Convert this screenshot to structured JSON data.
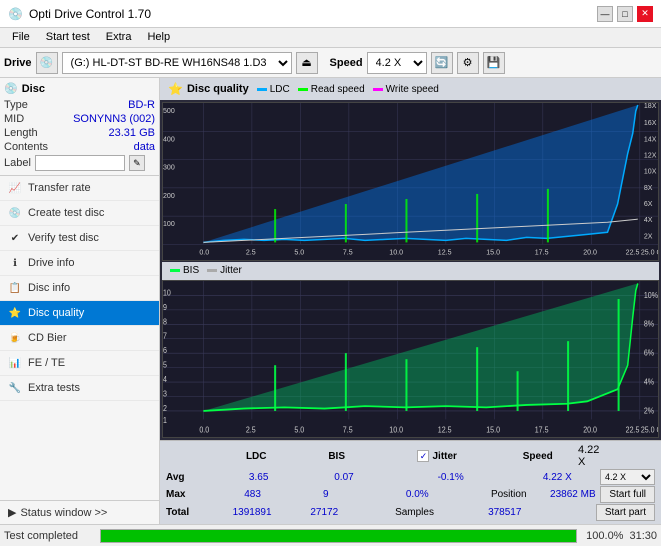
{
  "titleBar": {
    "title": "Opti Drive Control 1.70",
    "icon": "💿",
    "minimizeBtn": "—",
    "maximizeBtn": "□",
    "closeBtn": "✕"
  },
  "menuBar": {
    "items": [
      "File",
      "Start test",
      "Extra",
      "Help"
    ]
  },
  "driveBar": {
    "label": "Drive",
    "driveValue": "(G:)  HL-DT-ST BD-RE  WH16NS48 1.D3",
    "speedLabel": "Speed",
    "speedValue": "4.2 X"
  },
  "disc": {
    "title": "Disc",
    "typeLabel": "Type",
    "typeValue": "BD-R",
    "midLabel": "MID",
    "midValue": "SONYNN3 (002)",
    "lengthLabel": "Length",
    "lengthValue": "23.31 GB",
    "contentsLabel": "Contents",
    "contentsValue": "data",
    "labelLabel": "Label",
    "labelValue": ""
  },
  "nav": {
    "items": [
      {
        "id": "transfer-rate",
        "label": "Transfer rate",
        "icon": "📈"
      },
      {
        "id": "create-test-disc",
        "label": "Create test disc",
        "icon": "💿"
      },
      {
        "id": "verify-test-disc",
        "label": "Verify test disc",
        "icon": "✔"
      },
      {
        "id": "drive-info",
        "label": "Drive info",
        "icon": "ℹ"
      },
      {
        "id": "disc-info",
        "label": "Disc info",
        "icon": "📋"
      },
      {
        "id": "disc-quality",
        "label": "Disc quality",
        "icon": "⭐",
        "active": true
      },
      {
        "id": "cd-bier",
        "label": "CD Bier",
        "icon": "🍺"
      },
      {
        "id": "fe-te",
        "label": "FE / TE",
        "icon": "📊"
      },
      {
        "id": "extra-tests",
        "label": "Extra tests",
        "icon": "🔧"
      }
    ],
    "statusWindow": "Status window >>"
  },
  "discQuality": {
    "title": "Disc quality",
    "legend": {
      "ldc": "LDC",
      "readSpeed": "Read speed",
      "writeSpeed": "Write speed"
    },
    "legend2": {
      "bis": "BIS",
      "jitter": "Jitter"
    }
  },
  "stats": {
    "headers": [
      "LDC",
      "BIS",
      "Jitter",
      "Speed"
    ],
    "avgLabel": "Avg",
    "avgLDC": "3.65",
    "avgBIS": "0.07",
    "avgJitter": "-0.1%",
    "avgSpeed": "",
    "maxLabel": "Max",
    "maxLDC": "483",
    "maxBIS": "9",
    "maxJitter": "0.0%",
    "maxSpeed": "",
    "totalLabel": "Total",
    "totalLDC": "1391891",
    "totalBIS": "27172",
    "positionLabel": "Position",
    "positionValue": "23862 MB",
    "samplesLabel": "Samples",
    "samplesValue": "378517",
    "speedValue": "4.22 X",
    "speedSelect": "4.2 X",
    "startFullBtn": "Start full",
    "startPartBtn": "Start part"
  },
  "bottomBar": {
    "statusText": "Test completed",
    "progressPct": 100,
    "progressLabel": "100.0%",
    "timeLabel": "31:30"
  },
  "colors": {
    "accent": "#0078d4",
    "ldcColor": "#00aaff",
    "bisColor": "#00ff44",
    "jitterColor": "#ffffff",
    "readColor": "#00ff00",
    "writeColor": "#ff00ff",
    "gridColor": "#3a3a5a",
    "bgColor": "#1e1e2e"
  }
}
